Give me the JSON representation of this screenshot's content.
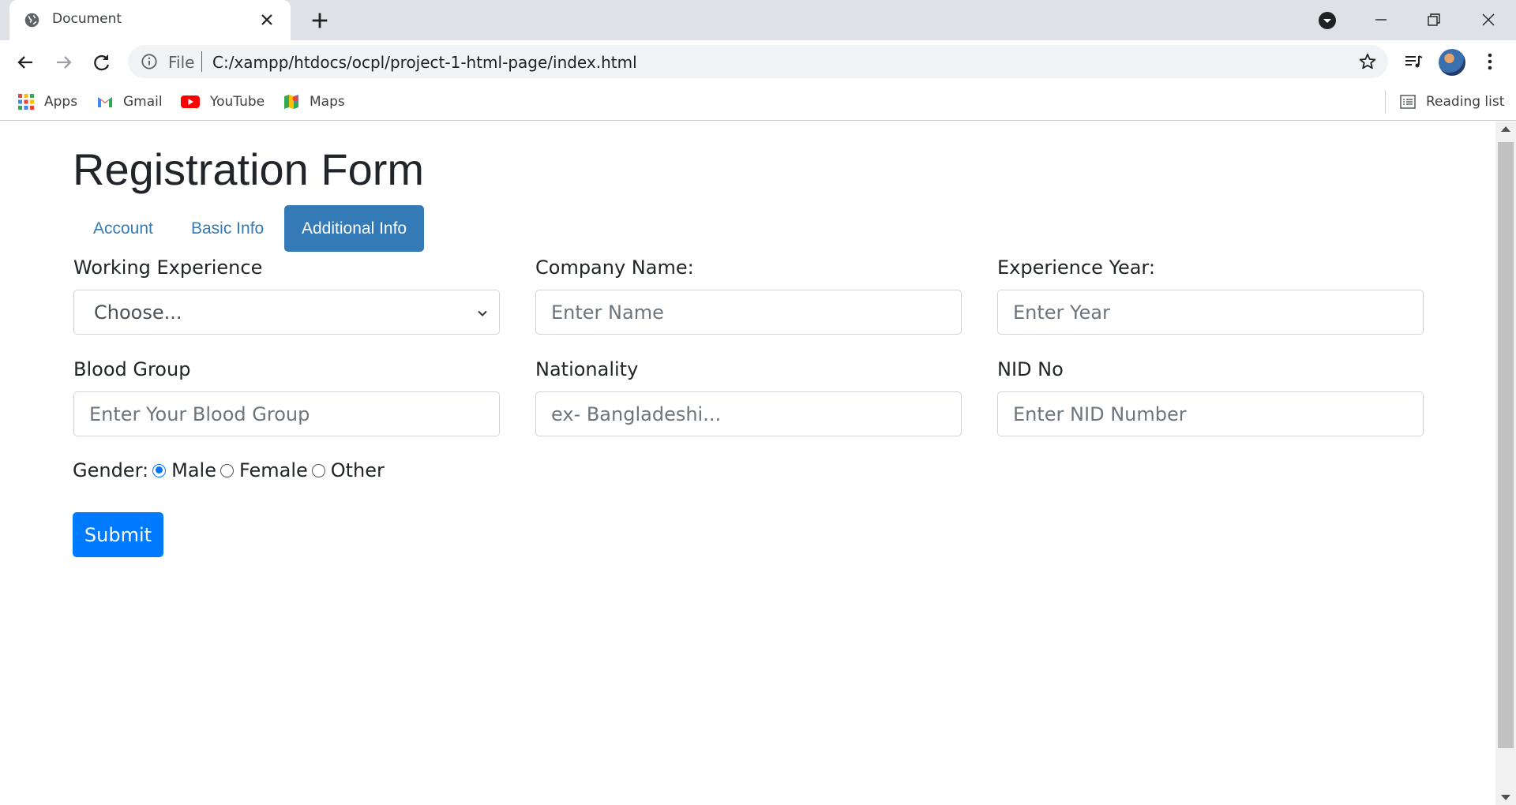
{
  "browser": {
    "tab_title": "Document",
    "url_scheme": "File",
    "url": "C:/xampp/htdocs/ocpl/project-1-html-page/index.html"
  },
  "bookmarks": {
    "items": [
      {
        "label": "Apps",
        "icon": "apps-grid-icon"
      },
      {
        "label": "Gmail",
        "icon": "gmail-icon"
      },
      {
        "label": "YouTube",
        "icon": "youtube-icon"
      },
      {
        "label": "Maps",
        "icon": "maps-icon"
      }
    ],
    "reading_list": "Reading list"
  },
  "form": {
    "title": "Registration Form",
    "tabs": [
      {
        "label": "Account",
        "active": false
      },
      {
        "label": "Basic Info",
        "active": false
      },
      {
        "label": "Additional Info",
        "active": true
      }
    ],
    "fields": {
      "working_experience": {
        "label": "Working Experience",
        "value": "Choose..."
      },
      "company_name": {
        "label": "Company Name:",
        "placeholder": "Enter Name"
      },
      "experience_year": {
        "label": "Experience Year:",
        "placeholder": "Enter Year"
      },
      "blood_group": {
        "label": "Blood Group",
        "placeholder": "Enter Your Blood Group"
      },
      "nationality": {
        "label": "Nationality",
        "placeholder": "ex- Bangladeshi..."
      },
      "nid_no": {
        "label": "NID No",
        "placeholder": "Enter NID Number"
      }
    },
    "gender": {
      "label": "Gender:",
      "options": [
        "Male",
        "Female",
        "Other"
      ],
      "selected": "Male"
    },
    "submit_label": "Submit"
  },
  "colors": {
    "primary": "#007bff",
    "tab_active": "#337ab7",
    "link": "#337ab7"
  }
}
